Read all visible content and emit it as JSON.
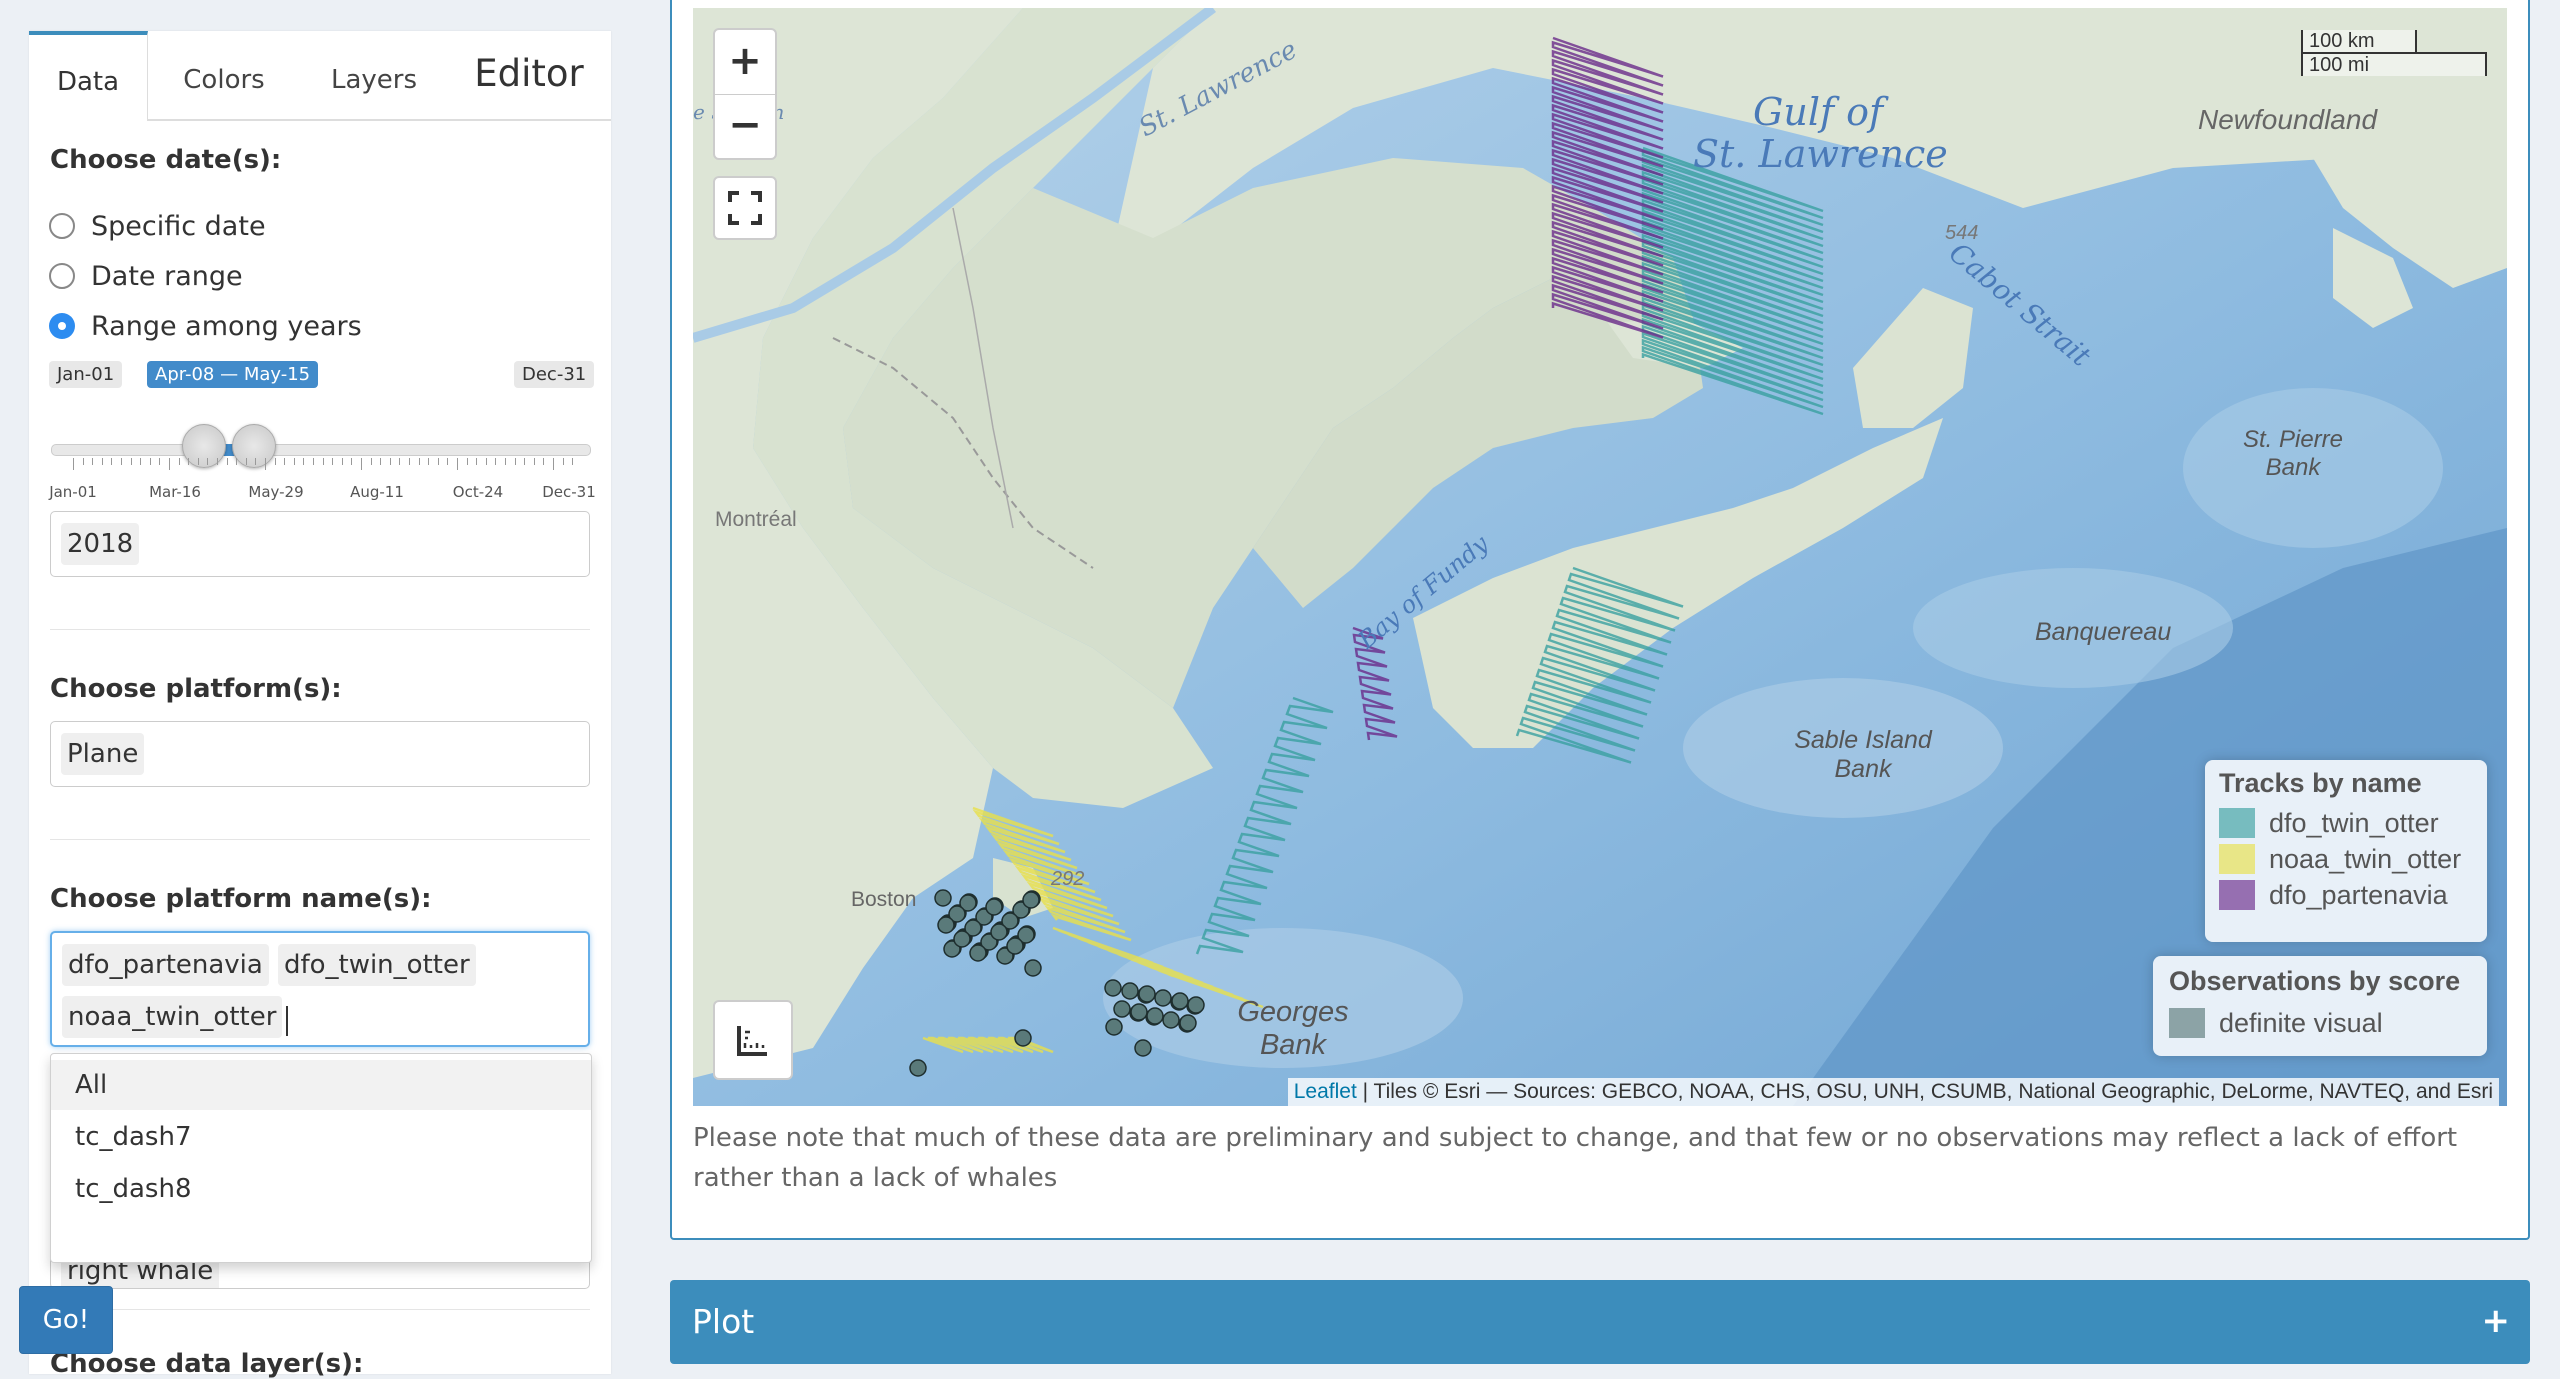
{
  "sidebar": {
    "tabs": [
      {
        "label": "Data"
      },
      {
        "label": "Colors"
      },
      {
        "label": "Layers"
      },
      {
        "label": "Editor"
      }
    ],
    "date_section": {
      "label": "Choose date(s):",
      "options": [
        {
          "label": "Specific date",
          "selected": false
        },
        {
          "label": "Date range",
          "selected": false
        },
        {
          "label": "Range among years",
          "selected": true
        }
      ],
      "slider": {
        "min_label": "Jan-01",
        "max_label": "Dec-31",
        "value_label": "Apr-08 — May-15",
        "value_start": "Apr-08",
        "value_end": "May-15",
        "tick_labels": [
          "Jan-01",
          "Mar-16",
          "May-29",
          "Aug-11",
          "Oct-24",
          "Dec-31"
        ]
      },
      "years": [
        "2018"
      ]
    },
    "platform_section": {
      "label": "Choose platform(s):",
      "selected": [
        "Plane"
      ]
    },
    "platform_name_section": {
      "label": "Choose platform name(s):",
      "selected": [
        "dfo_partenavia",
        "dfo_twin_otter",
        "noaa_twin_otter"
      ],
      "dropdown_options": [
        "All",
        "tc_dash7",
        "tc_dash8"
      ],
      "hidden_chip": "right whale"
    },
    "data_layer_section": {
      "label": "Choose data layer(s):"
    },
    "go_label": "Go!"
  },
  "map": {
    "zoom_in_label": "+",
    "zoom_out_label": "−",
    "fullscreen_icon": "fullscreen-icon",
    "measure_icon": "ruler-icon",
    "scale": {
      "km": "100 km",
      "mi": "100 mi"
    },
    "labels": {
      "gulf1": "Gulf of",
      "gulf2": "St. Lawrence",
      "stlawrence": "St. Lawrence",
      "jean": "e St-Jean",
      "newfoundland": "Newfoundland",
      "cabot": "Cabot Strait",
      "d544": "544",
      "stpierre1": "St. Pierre",
      "stpierre2": "Bank",
      "montreal": "Montréal",
      "fundy": "Bay of Fundy",
      "banquereau": "Banquereau",
      "sable1": "Sable Island",
      "sable2": "Bank",
      "boston": "Boston",
      "d292": "292",
      "georges1": "Georges",
      "georges2": "Bank"
    },
    "tracks_legend": {
      "title": "Tracks by name",
      "items": [
        {
          "label": "dfo_twin_otter",
          "color": "#3aa0a0"
        },
        {
          "label": "noaa_twin_otter",
          "color": "#e8e04a"
        },
        {
          "label": "dfo_partenavia",
          "color": "#6a2a8a"
        }
      ]
    },
    "obs_legend": {
      "title": "Observations by score",
      "items": [
        {
          "label": "definite visual",
          "color": "#5a7a7a"
        }
      ]
    },
    "attribution": {
      "leaflet": "Leaflet",
      "rest": " | Tiles © Esri — Sources: GEBCO, NOAA, CHS, OSU, UNH, CSUMB, National Geographic, DeLorme, NAVTEQ, and Esri"
    }
  },
  "note": "Please note that much of these data are preliminary and subject to change, and that few or no observations may reflect a lack of effort rather than a lack of whales",
  "plot_panel": {
    "title": "Plot",
    "toggle": "+"
  }
}
